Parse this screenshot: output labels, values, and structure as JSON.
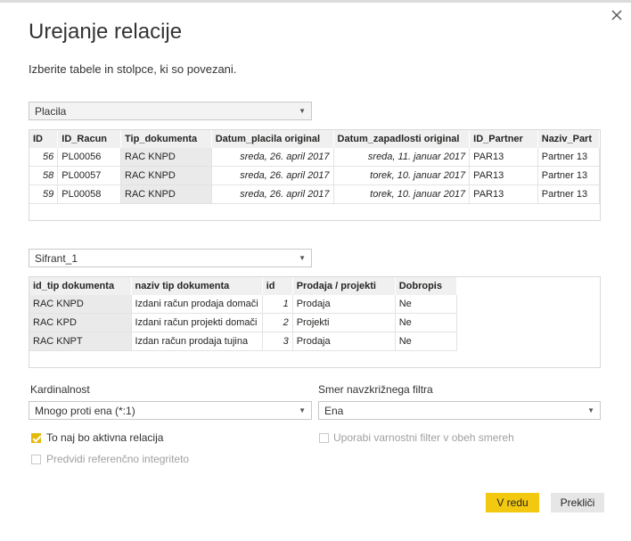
{
  "dialog": {
    "title": "Urejanje relacije",
    "subtitle": "Izberite tabele in stolpce, ki so povezani."
  },
  "table1": {
    "selected": "Placila",
    "columns": [
      "ID",
      "ID_Racun",
      "Tip_dokumenta",
      "Datum_placila original",
      "Datum_zapadlosti original",
      "ID_Partner",
      "Naziv_Part"
    ],
    "rows": [
      [
        "56",
        "PL00056",
        "RAC KNPD",
        "sreda, 26. april 2017",
        "sreda, 11. januar 2017",
        "PAR13",
        "Partner 13"
      ],
      [
        "58",
        "PL00057",
        "RAC KNPD",
        "sreda, 26. april 2017",
        "torek, 10. januar 2017",
        "PAR13",
        "Partner 13"
      ],
      [
        "59",
        "PL00058",
        "RAC KNPD",
        "sreda, 26. april 2017",
        "torek, 10. januar 2017",
        "PAR13",
        "Partner 13"
      ]
    ]
  },
  "table2": {
    "selected": "Sifrant_1",
    "columns": [
      "id_tip dokumenta",
      "naziv tip dokumenta",
      "id",
      "Prodaja / projekti",
      "Dobropis"
    ],
    "rows": [
      [
        "RAC KNPD",
        "Izdani račun prodaja domači",
        "1",
        "Prodaja",
        "Ne"
      ],
      [
        "RAC KPD",
        "Izdani račun projekti domači",
        "2",
        "Projekti",
        "Ne"
      ],
      [
        "RAC KNPT",
        "Izdan račun prodaja tujina",
        "3",
        "Prodaja",
        "Ne"
      ]
    ]
  },
  "cardinality": {
    "label": "Kardinalnost",
    "value": "Mnogo proti ena (*:1)"
  },
  "crossfilter": {
    "label": "Smer navzkrižnega filtra",
    "value": "Ena"
  },
  "options": {
    "active": {
      "label": "To naj bo aktivna relacija",
      "checked": true
    },
    "security": {
      "label": "Uporabi varnostni filter v obeh smereh",
      "checked": false
    },
    "integrity": {
      "label": "Predvidi referenčno integriteto",
      "checked": false
    }
  },
  "buttons": {
    "ok": "V redu",
    "cancel": "Prekliči"
  },
  "colors": {
    "accent": "#f2c811"
  }
}
